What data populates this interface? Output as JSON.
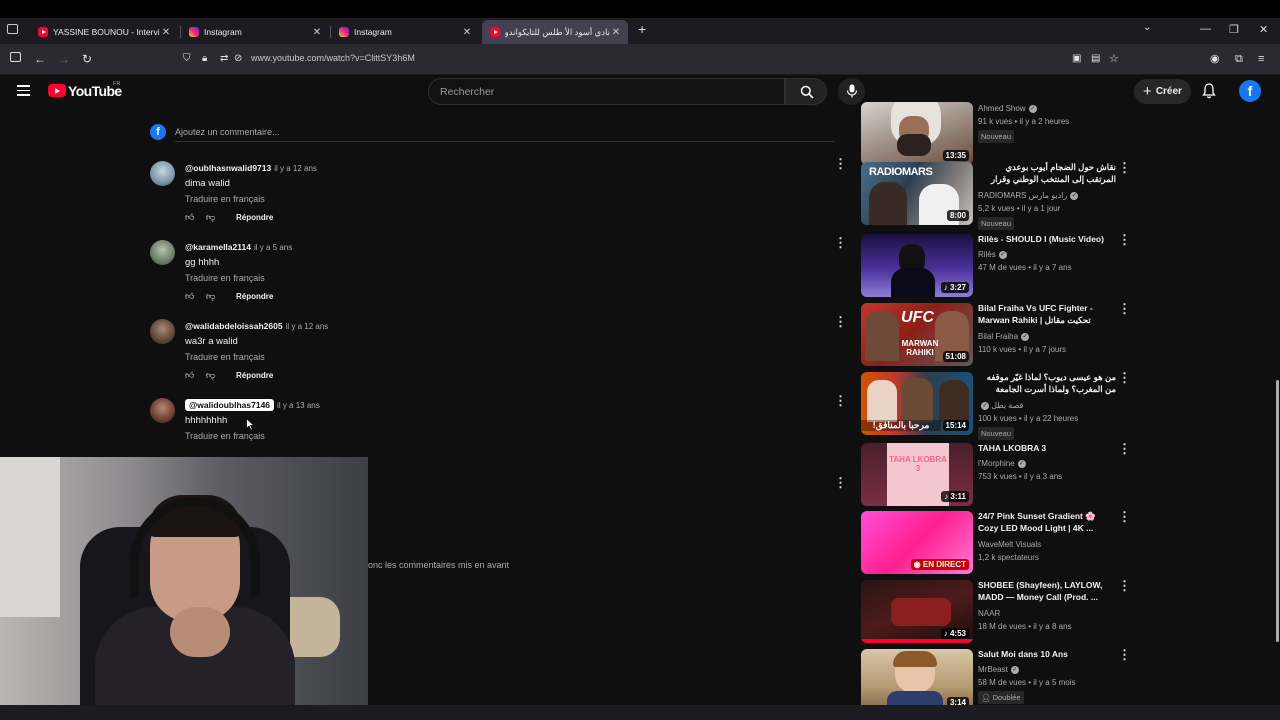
{
  "browser": {
    "tabs": [
      {
        "label": "YASSINE BOUNOU - Interview -",
        "icon": "youtube-icon",
        "active": false
      },
      {
        "label": "Instagram",
        "icon": "instagram-icon",
        "active": false
      },
      {
        "label": "Instagram",
        "icon": "instagram-icon",
        "active": false
      },
      {
        "label": "نادي أسود الأ طلس للتايكواندو ...",
        "icon": "youtube-icon",
        "active": true
      }
    ],
    "url": "www.youtube.com/watch?v=ClittSY3h6M"
  },
  "youtube": {
    "logo_text": "YouTube",
    "region": "FR",
    "search_placeholder": "Rechercher",
    "create_label": "Créer",
    "account_initial": "f"
  },
  "comments": {
    "add_placeholder": "Ajoutez un commentaire...",
    "account_initial": "f",
    "translate_label": "Traduire en français",
    "reply_label": "Répondre",
    "items": [
      {
        "handle": "@oublhasnwalid9713",
        "time": "il y a 12 ans",
        "text": "dima walid"
      },
      {
        "handle": "@karamella2114",
        "time": "il y a 5 ans",
        "text": "gg hhhh"
      },
      {
        "handle": "@walidabdeloissah2605",
        "time": "il y a 12 ans",
        "text": "wa3r a walid"
      },
      {
        "handle": "@walidoublhas7146",
        "time": "il y a 13 ans",
        "text": "hhhhhhhh"
      }
    ],
    "pinned_note": "onc les commentaires mis en avant"
  },
  "sidebar": {
    "videos": [
      {
        "title": "",
        "channel": "Ahmed Show",
        "meta": "91 k vues • il y a 2 heures",
        "duration": "13:35",
        "badge": "Nouveau"
      },
      {
        "title": "نقاش حول الضجام أيوب بوعدي المرتقب إلى المنتخب الوطني وقرار عيسى ديوب بتمثيل...",
        "channel": "RADIOMARS راديو مارس",
        "meta": "5,2 k vues • il y a 1 jour",
        "duration": "8:00",
        "badge": "Nouveau"
      },
      {
        "title": "Rilès - SHOULD I (Music Video)",
        "channel": "Rilès",
        "meta": "47 M de vues • il y a 7 ans",
        "duration": "3:27",
        "badge": ""
      },
      {
        "title": "Bilal Fraiha Vs UFC Fighter - Marwan Rahiki | تحكيت مقاتل مغربي...",
        "channel": "Bilal Fraiha",
        "meta": "110 k vues • il y a 7 jours",
        "duration": "51:08",
        "badge": ""
      },
      {
        "title": "من هو عيسى ديوب؟ لماذا غيّر موقفه من المغرب؟ ولماذا أسرت الجامعة على...",
        "channel": "قصة بطل",
        "meta": "100 k vues • il y a 22 heures",
        "duration": "15:14",
        "badge": "Nouveau"
      },
      {
        "title": "TAHA LKOBRA 3",
        "channel": "l'Morphine",
        "meta": "753 k vues • il y a 3 ans",
        "duration": "3:11",
        "badge": ""
      },
      {
        "title": "24/7 Pink Sunset Gradient 🌸 Cozy LED Mood Light | 4K ...",
        "channel": "WaveMelt Visuals",
        "meta": "1,2 k spectateurs",
        "duration": "EN DIRECT",
        "badge": ""
      },
      {
        "title": "SHOBEE (Shayfeen), LAYLOW, MADD — Money Call (Prod. ...",
        "channel": "NAAR",
        "meta": "18 M de vues • il y a 8 ans",
        "duration": "4:53",
        "badge": ""
      },
      {
        "title": "Salut Moi dans 10 Ans",
        "channel": "MrBeast",
        "meta": "58 M de vues • il y a 5 mois",
        "duration": "3:14",
        "badge": "Doublée"
      }
    ]
  },
  "thumb_text": {
    "radiomars": "RADIOMARS",
    "ufc": "UFC",
    "marwan": "MARWAN RAHIKI",
    "marhaba": "مرحبا بالمنافق!",
    "taha": "TAHA LKOBRA 3"
  },
  "colors": {
    "background": "#0f0f0f",
    "youtube_red": "#ff0033",
    "facebook_blue": "#1877f2"
  }
}
